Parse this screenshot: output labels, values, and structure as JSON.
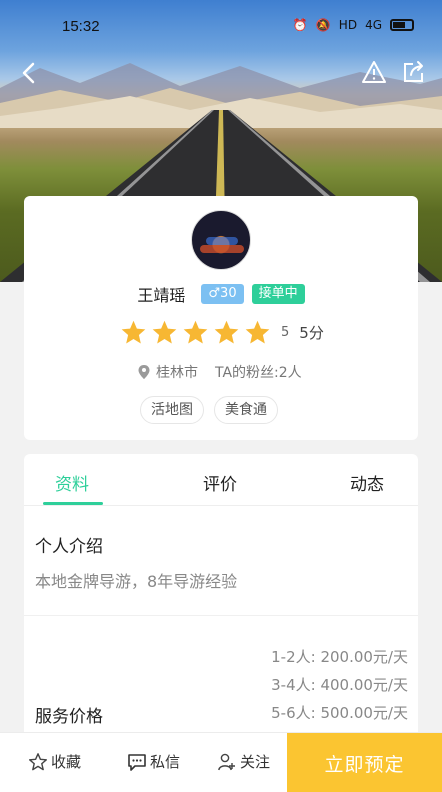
{
  "status_bar": {
    "time": "15:32",
    "network": "4G",
    "hd": "HD"
  },
  "nav": {
    "back_icon": "chevron-left-icon",
    "report_icon": "warning-icon",
    "share_icon": "share-icon"
  },
  "profile": {
    "name": "王靖瑶",
    "age_badge": "♂30",
    "status_badge": "接单中",
    "rating_stars": 5,
    "rating_count": "5",
    "rating_score": "5分",
    "city": "桂林市",
    "fans": "TA的粉丝:2人",
    "tags": [
      "活地图",
      "美食通"
    ]
  },
  "tabs": {
    "items": [
      "资料",
      "评价",
      "动态"
    ],
    "active": 0
  },
  "info": {
    "intro_title": "个人介绍",
    "intro_text": "本地金牌导游，8年导游经验",
    "price_title": "服务价格",
    "prices": [
      "1-2人: 200.00元/天",
      "3-4人: 400.00元/天",
      "5-6人: 500.00元/天"
    ]
  },
  "bottom_bar": {
    "favorite": "收藏",
    "message": "私信",
    "follow": "关注",
    "book": "立即预定"
  },
  "colors": {
    "accent_green": "#2ecf9a",
    "age_blue": "#7cc0f2",
    "star_yellow": "#f7b733",
    "book_yellow": "#fbc531"
  }
}
